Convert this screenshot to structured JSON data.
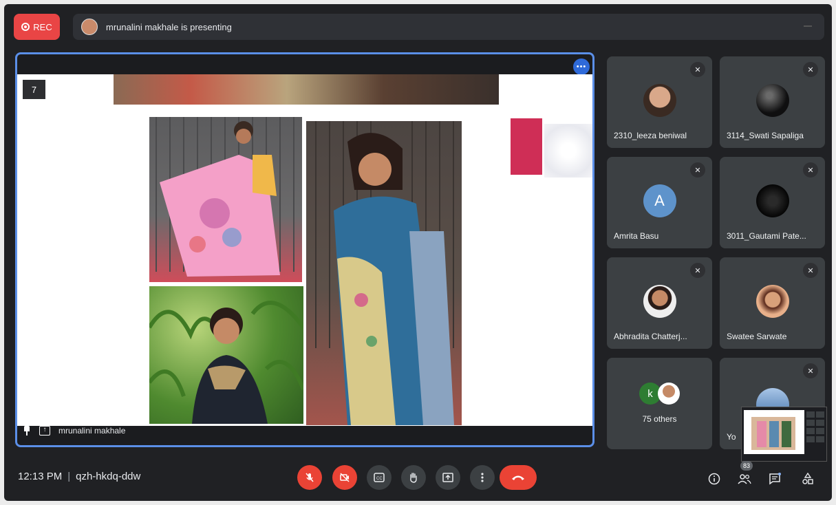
{
  "topbar": {
    "rec_label": "REC",
    "presenting_text": "mrunalini makhale is presenting"
  },
  "presentation": {
    "slide_number": "7",
    "presenter_name": "mrunalini makhale",
    "more_label": "•••"
  },
  "participants": [
    {
      "name": "2310_leeza beniwal",
      "avatar_type": "photo"
    },
    {
      "name": "3114_Swati Sapaliga",
      "avatar_type": "photo"
    },
    {
      "name": "Amrita Basu",
      "avatar_type": "letter",
      "letter": "A",
      "color": "#5e93cb"
    },
    {
      "name": "3011_Gautami Pate...",
      "avatar_type": "photo"
    },
    {
      "name": "Abhradita Chatterj...",
      "avatar_type": "photo"
    },
    {
      "name": "Swatee Sarwate",
      "avatar_type": "photo"
    }
  ],
  "others": {
    "label": "75 others",
    "letter": "k"
  },
  "self_tile": {
    "label": "Yo"
  },
  "bottombar": {
    "time": "12:13 PM",
    "separator": "|",
    "meeting_code": "qzh-hkdq-ddw",
    "participant_count": "83"
  },
  "icons": {
    "mic_off": "mic-off-icon",
    "cam_off": "camera-off-icon",
    "cc": "captions-icon",
    "hand": "raise-hand-icon",
    "present": "present-icon",
    "more": "more-vert-icon",
    "end": "end-call-icon",
    "info": "info-icon",
    "people": "people-icon",
    "chat": "chat-icon",
    "activities": "activities-icon"
  },
  "colors": {
    "accent": "#5b8fe8",
    "rec": "#e94545",
    "end_call": "#ea4335"
  }
}
